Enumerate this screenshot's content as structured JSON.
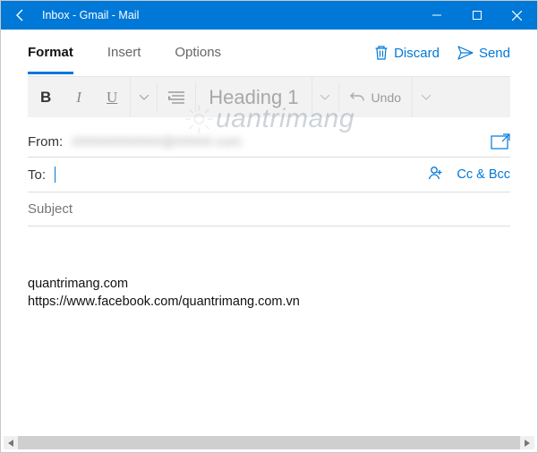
{
  "window": {
    "title": "Inbox - Gmail - Mail"
  },
  "tabs": {
    "format": "Format",
    "insert": "Insert",
    "options": "Options"
  },
  "actions": {
    "discard": "Discard",
    "send": "Send"
  },
  "toolbar": {
    "bold": "B",
    "italic": "I",
    "underline": "U",
    "heading": "Heading 1",
    "undo": "Undo"
  },
  "fields": {
    "from_label": "From:",
    "from_value": "############@#####.com",
    "to_label": "To:",
    "to_value": "",
    "ccbcc": "Cc & Bcc",
    "subject_placeholder": "Subject"
  },
  "body": {
    "line1": "quantrimang.com",
    "line2": "https://www.facebook.com/quantrimang.com.vn"
  },
  "watermark": "uantrimang"
}
